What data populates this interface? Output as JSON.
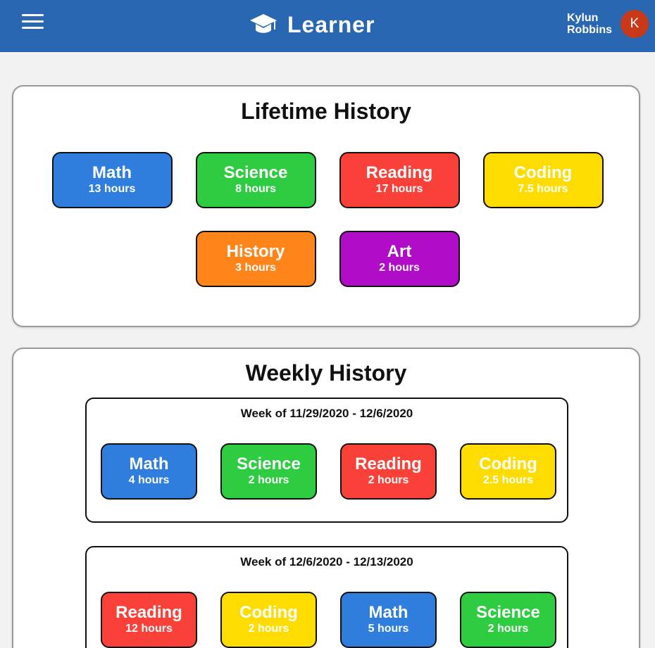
{
  "header": {
    "brand": "Learner",
    "brand_icon": "graduation-cap-icon",
    "menu_icon": "hamburger-menu-icon",
    "user_first": "Kylun",
    "user_last": "Robbins",
    "avatar_initial": "K",
    "colors": {
      "bar": "#2a67b2",
      "avatar": "#c8391a"
    }
  },
  "lifetime": {
    "title": "Lifetime History",
    "subjects": [
      {
        "name": "Math",
        "hours": "13 hours",
        "color": "#2f7ddd"
      },
      {
        "name": "Science",
        "hours": "8 hours",
        "color": "#2ecc40"
      },
      {
        "name": "Reading",
        "hours": "17 hours",
        "color": "#fa4139"
      },
      {
        "name": "Coding",
        "hours": "7.5 hours",
        "color": "#ffdc00"
      },
      {
        "name": "History",
        "hours": "3 hours",
        "color": "#ff851b"
      },
      {
        "name": "Art",
        "hours": "2 hours",
        "color": "#b10dc9"
      }
    ]
  },
  "weekly": {
    "title": "Weekly History",
    "weeks": [
      {
        "label": "Week of 11/29/2020 - 12/6/2020",
        "subjects": [
          {
            "name": "Math",
            "hours": "4 hours",
            "color": "#2f7ddd"
          },
          {
            "name": "Science",
            "hours": "2 hours",
            "color": "#2ecc40"
          },
          {
            "name": "Reading",
            "hours": "2 hours",
            "color": "#fa4139"
          },
          {
            "name": "Coding",
            "hours": "2.5 hours",
            "color": "#ffdc00"
          }
        ]
      },
      {
        "label": "Week of 12/6/2020 - 12/13/2020",
        "subjects": [
          {
            "name": "Reading",
            "hours": "12 hours",
            "color": "#fa4139"
          },
          {
            "name": "Coding",
            "hours": "2 hours",
            "color": "#ffdc00"
          },
          {
            "name": "Math",
            "hours": "5 hours",
            "color": "#2f7ddd"
          },
          {
            "name": "Science",
            "hours": "2 hours",
            "color": "#2ecc40"
          }
        ]
      }
    ]
  }
}
